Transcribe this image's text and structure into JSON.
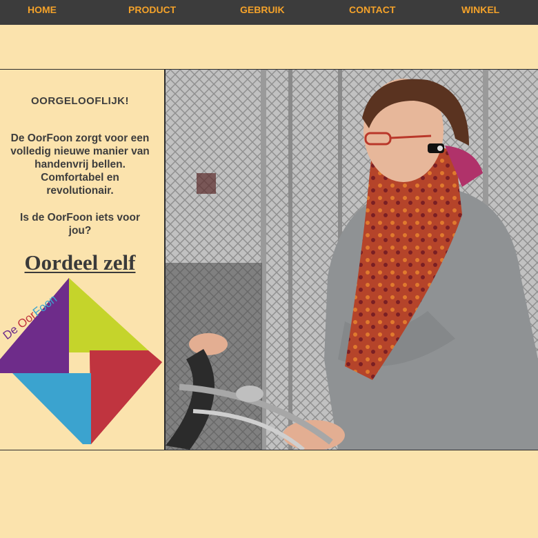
{
  "nav": {
    "items": [
      {
        "label": "HOME"
      },
      {
        "label": "PRODUCT"
      },
      {
        "label": "GEBRUIK"
      },
      {
        "label": "CONTACT"
      },
      {
        "label": "WINKEL"
      }
    ]
  },
  "main": {
    "headline": "OORGELOOFLIJK!",
    "intro": "De OorFoon zorgt voor een\nvolledig nieuwe manier van\nhandenvrij bellen.\nComfortabel en\nrevolutionair.",
    "question": "Is de OorFoon iets voor\njou?",
    "cta": "Oordeel zelf"
  },
  "logo": {
    "text": "De OorFoon",
    "colors": {
      "purple": "#6e2c8a",
      "lime": "#c5d42b",
      "blue": "#3ba3cf",
      "red": "#c0343f"
    }
  },
  "colors": {
    "background": "#fbe3ad",
    "navbar": "#3c3c3c",
    "nav_text": "#f4a22a",
    "body_text": "#3d3d3d"
  }
}
